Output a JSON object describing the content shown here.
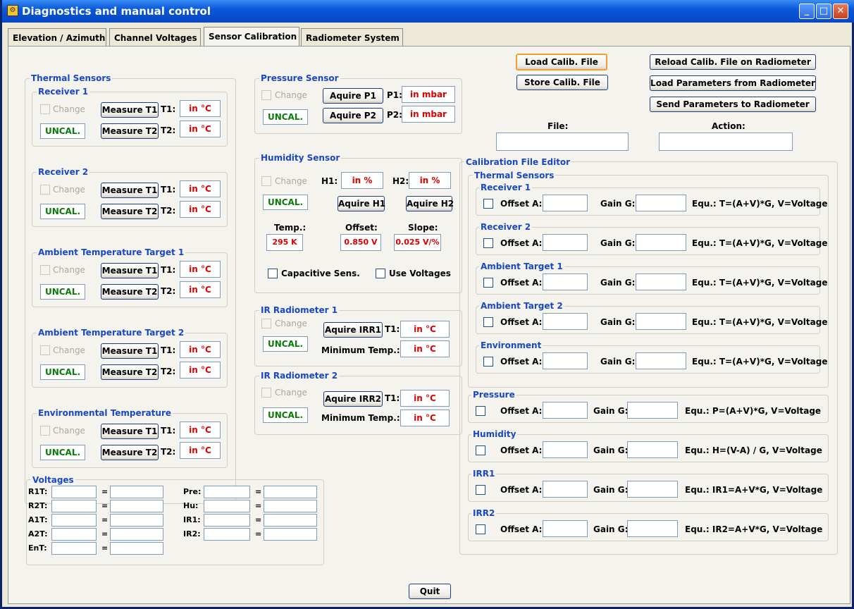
{
  "window": {
    "title": "Diagnostics and manual control",
    "minimize": "_",
    "maximize": "□",
    "close": "✕"
  },
  "tabs": [
    {
      "label": "Elevation / Azimuth"
    },
    {
      "label": "Channel Voltages"
    },
    {
      "label": "Sensor Calibration"
    },
    {
      "label": "Radiometer System"
    }
  ],
  "thermal": {
    "title": "Thermal Sensors",
    "change": "Change",
    "uncal": "UNCAL.",
    "t1_label": "T1:",
    "t2_label": "T2:",
    "unit": "in °C",
    "groups": [
      {
        "title": "Receiver 1",
        "m1": "Measure T1",
        "m2": "Measure T2"
      },
      {
        "title": "Receiver 2",
        "m1": "Measure T1",
        "m2": "Measure T2"
      },
      {
        "title": "Ambient Temperature Target 1",
        "m1": "Measure T1",
        "m2": "Measure T2"
      },
      {
        "title": "Ambient Temperature Target 2",
        "m1": "Measure T1",
        "m2": "Measure T2"
      },
      {
        "title": "Environmental Temperature",
        "m1": "Measure T1",
        "m2": "Measure T2"
      }
    ]
  },
  "pressure": {
    "title": "Pressure Sensor",
    "change": "Change",
    "uncal": "UNCAL.",
    "btn1": "Aquire P1",
    "btn2": "Aquire P2",
    "p1_label": "P1:",
    "p2_label": "P2:",
    "p1": "in mbar",
    "p2": "in mbar"
  },
  "humidity": {
    "title": "Humidity Sensor",
    "change": "Change",
    "uncal": "UNCAL.",
    "h1_label": "H1:",
    "h2_label": "H2:",
    "h1": "in %",
    "h2": "in %",
    "btn1": "Aquire H1",
    "btn2": "Aquire H2",
    "temp_label": "Temp.:",
    "offset_label": "Offset:",
    "slope_label": "Slope:",
    "temp": "295 K",
    "offset": "0.850 V",
    "slope": "0.025 V/%",
    "cap": "Capacitive Sens.",
    "usev": "Use Voltages"
  },
  "irr1": {
    "title": "IR Radiometer 1",
    "change": "Change",
    "uncal": "UNCAL.",
    "btn": "Aquire IRR1",
    "t1_label": "T1:",
    "t1": "in °C",
    "min_label": "Minimum Temp.:",
    "min": "in °C"
  },
  "irr2": {
    "title": "IR Radiometer 2",
    "change": "Change",
    "uncal": "UNCAL.",
    "btn": "Aquire IRR2",
    "t1_label": "T1:",
    "t1": "in °C",
    "min_label": "Minimum Temp.:",
    "min": "in °C"
  },
  "voltages": {
    "title": "Voltages",
    "eq": "=",
    "left": [
      "R1T:",
      "R2T:",
      "A1T:",
      "A2T:",
      "EnT:"
    ],
    "right": [
      "Pre:",
      "Hu:",
      "IR1:",
      "IR2:"
    ]
  },
  "file": {
    "load": "Load Calib. File",
    "store": "Store Calib. File",
    "reload": "Reload Calib. File on Radiometer",
    "loadparams": "Load Parameters from Radiometer",
    "sendparams": "Send Parameters to Radiometer",
    "file_label": "File:",
    "action_label": "Action:"
  },
  "editor": {
    "title": "Calibration File Editor",
    "thermal_title": "Thermal Sensors",
    "offset": "Offset A:",
    "gain": "Gain G:",
    "thermal": [
      {
        "title": "Receiver 1",
        "eq": "Equ.: T=(A+V)*G, V=Voltage"
      },
      {
        "title": "Receiver 2",
        "eq": "Equ.: T=(A+V)*G, V=Voltage"
      },
      {
        "title": "Ambient Target 1",
        "eq": "Equ.: T=(A+V)*G, V=Voltage"
      },
      {
        "title": "Ambient Target 2",
        "eq": "Equ.: T=(A+V)*G, V=Voltage"
      },
      {
        "title": "Environment",
        "eq": "Equ.: T=(A+V)*G, V=Voltage"
      }
    ],
    "others": [
      {
        "title": "Pressure",
        "eq": "Equ.: P=(A+V)*G, V=Voltage"
      },
      {
        "title": "Humidity",
        "eq": "Equ.: H=(V-A) / G, V=Voltage"
      },
      {
        "title": "IRR1",
        "eq": "Equ.: IR1=A+V*G, V=Voltage"
      },
      {
        "title": "IRR2",
        "eq": "Equ.: IR2=A+V*G, V=Voltage"
      }
    ]
  },
  "quit": "Quit"
}
